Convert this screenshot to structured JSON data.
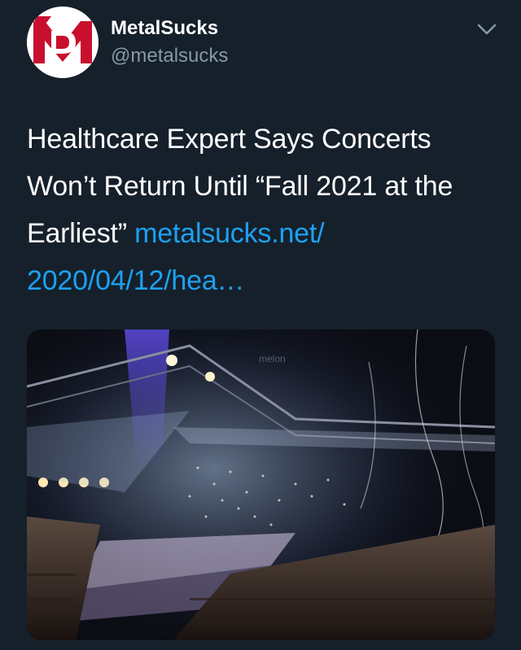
{
  "author": {
    "display_name": "MetalSucks",
    "handle": "@metalsucks",
    "avatar_icon": "metalsucks-logo-icon"
  },
  "tweet": {
    "text_before_link": "Healthcare Expert Says Concerts Won’t Return Until “Fall 2021 at the Earliest” ",
    "link_line1": "metalsucks.net/",
    "link_line2": "2020/04/12/hea…"
  },
  "media": {
    "description_icon": "concert-photo",
    "arena_sign": "melon"
  },
  "colors": {
    "background": "#15202b",
    "text": "#ffffff",
    "secondary": "#8899a6",
    "link": "#1da1f2",
    "logo_red": "#c8102e"
  }
}
